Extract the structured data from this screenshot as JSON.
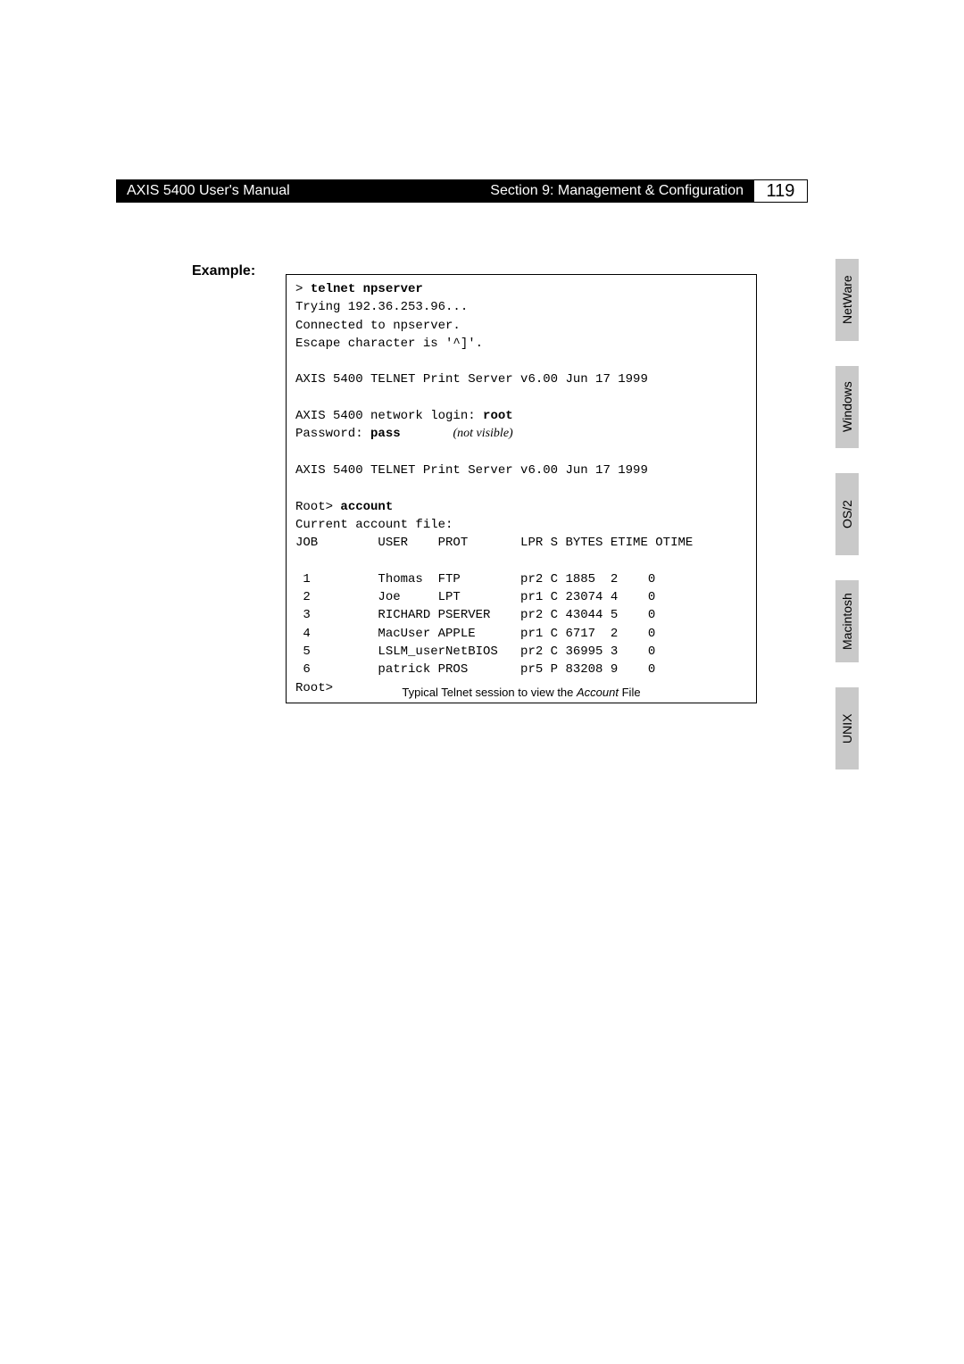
{
  "header": {
    "left": "AXIS 5400 User's Manual",
    "right": "Section 9: Management & Configuration",
    "page": "119"
  },
  "example_label": "Example:",
  "terminal": {
    "line1_prompt": "> ",
    "line1_cmd": "telnet npserver",
    "line2": "Trying 192.36.253.96...",
    "line3": "Connected to npserver.",
    "line4": "Escape character is '^]'.",
    "line6": "AXIS 5400 TELNET Print Server v6.00 Jun 17 1999",
    "line8_pre": "AXIS 5400 network login: ",
    "line8_bold": "root",
    "line9_pre": "Password: ",
    "line9_bold": "pass",
    "line9_pad": "       ",
    "line9_ital": "(not visible)",
    "line11": "AXIS 5400 TELNET Print Server v6.00 Jun 17 1999",
    "line13_pre": "Root> ",
    "line13_bold": "account",
    "line14": "Current account file:",
    "hdr": "JOB        USER    PROT       LPR S BYTES ETIME OTIME",
    "r1": " 1         Thomas  FTP        pr2 C 1885  2    0",
    "r2": " 2         Joe     LPT        pr1 C 23074 4    0",
    "r3": " 3         RICHARD PSERVER    pr2 C 43044 5    0",
    "r4": " 4         MacUser APPLE      pr1 C 6717  2    0",
    "r5": " 5         LSLM_userNetBIOS   pr2 C 36995 3    0",
    "r6": " 6         patrick PROS       pr5 P 83208 9    0",
    "lineEnd": "Root>"
  },
  "caption": {
    "pre": "Typical Telnet session to view the ",
    "ital": "Account",
    "post": " File"
  },
  "tabs": {
    "t1": "NetWare",
    "t2": "Windows",
    "t3": "OS/2",
    "t4": "Macintosh",
    "t5": "UNIX"
  },
  "chart_data": {
    "type": "table",
    "title": "Current account file",
    "columns": [
      "JOB",
      "USER",
      "PROT",
      "LPR",
      "S",
      "BYTES",
      "ETIME",
      "OTIME"
    ],
    "rows": [
      [
        1,
        "Thomas",
        "FTP",
        "pr2",
        "C",
        1885,
        2,
        0
      ],
      [
        2,
        "Joe",
        "LPT",
        "pr1",
        "C",
        23074,
        4,
        0
      ],
      [
        3,
        "RICHARD",
        "PSERVER",
        "pr2",
        "C",
        43044,
        5,
        0
      ],
      [
        4,
        "MacUser",
        "APPLE",
        "pr1",
        "C",
        6717,
        2,
        0
      ],
      [
        5,
        "LSLM_user",
        "NetBIOS",
        "pr2",
        "C",
        36995,
        3,
        0
      ],
      [
        6,
        "patrick",
        "PROS",
        "pr5",
        "P",
        83208,
        9,
        0
      ]
    ]
  }
}
